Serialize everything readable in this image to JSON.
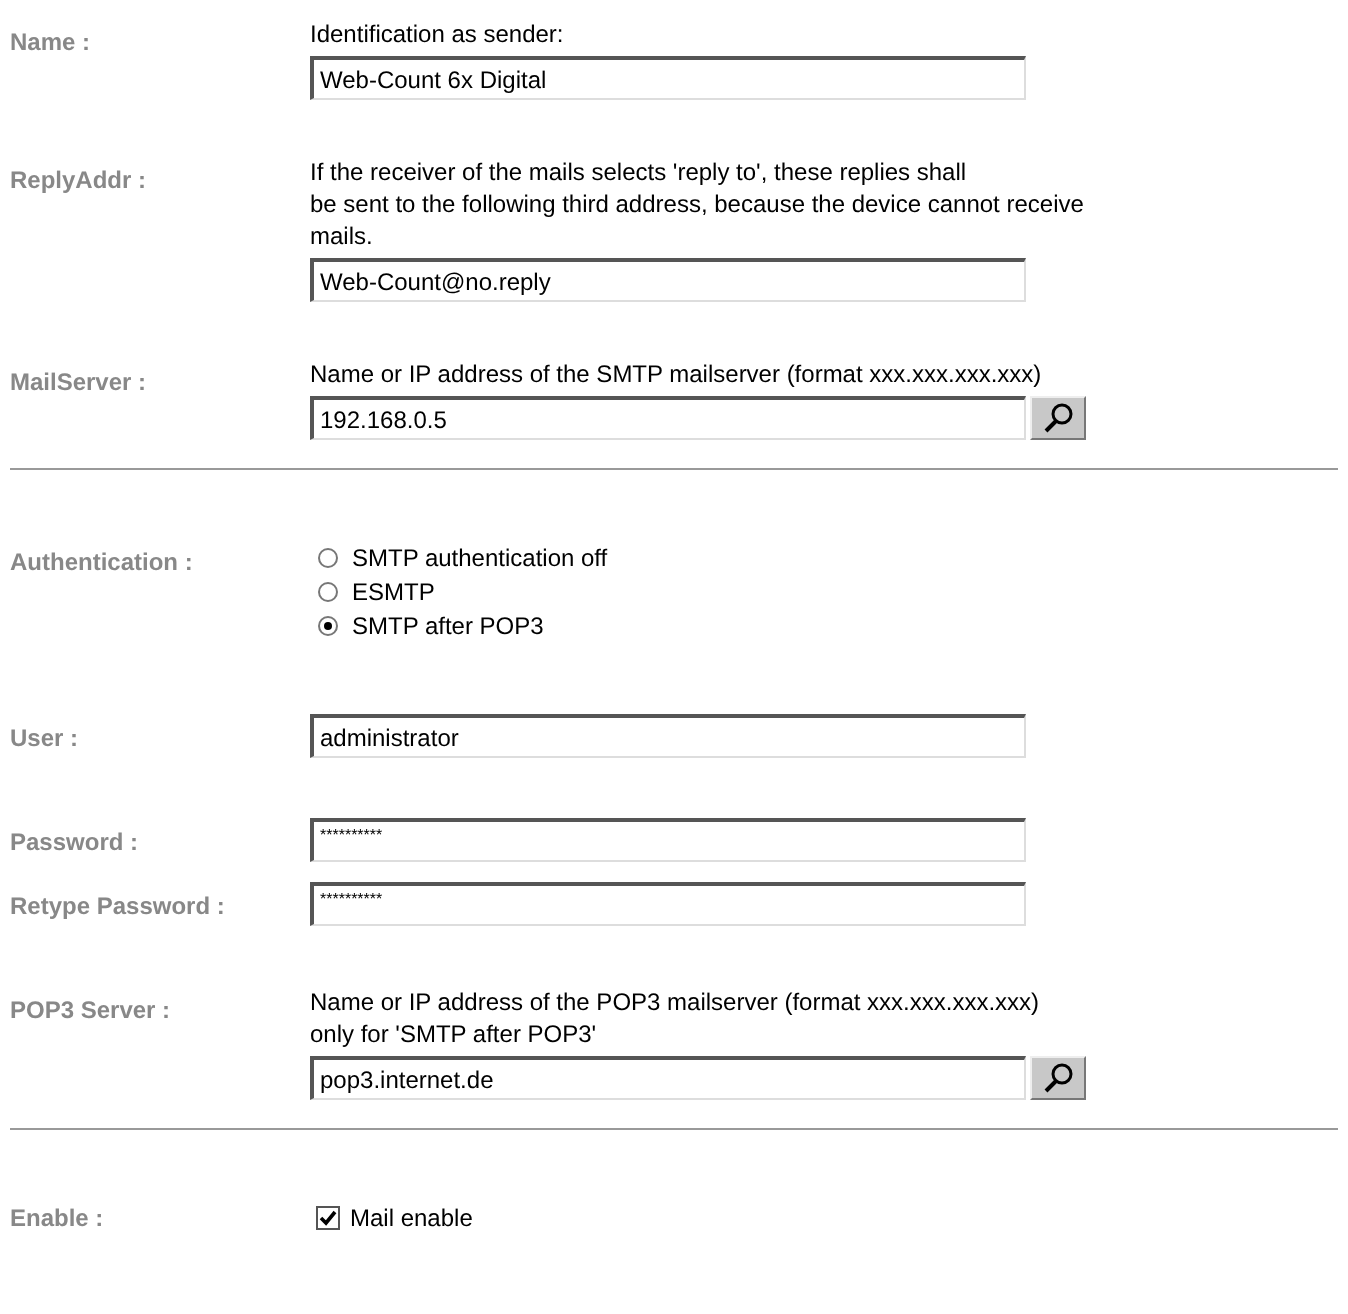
{
  "rows": [
    {
      "kind": "field",
      "label": "Name :",
      "description": [
        "Identification as sender:"
      ],
      "value": "Web-Count 6x Digital",
      "masked": false
    },
    {
      "kind": "field",
      "label": "ReplyAddr :",
      "description": [
        "If the receiver of the mails selects 'reply to', these replies shall",
        "be sent to the following third address, because the device cannot receive",
        "mails."
      ],
      "value": "Web-Count@no.reply",
      "masked": false
    },
    {
      "kind": "field",
      "label": "MailServer :",
      "description": [
        "Name or IP address of the SMTP mailserver (format xxx.xxx.xxx.xxx)"
      ],
      "value": "192.168.0.5",
      "masked": false,
      "search_button": true
    },
    {
      "kind": "divider"
    },
    {
      "kind": "radio",
      "label": "Authentication :",
      "options": [
        {
          "label": "SMTP authentication off",
          "selected": false
        },
        {
          "label": "ESMTP",
          "selected": false
        },
        {
          "label": "SMTP after POP3",
          "selected": true
        }
      ]
    },
    {
      "kind": "field",
      "label": "User :",
      "value": "administrator",
      "masked": false
    },
    {
      "kind": "field",
      "label": "Password :",
      "value": "**********",
      "masked": true
    },
    {
      "kind": "confirm_field",
      "label": "Retype Password :",
      "value": "**********",
      "masked": true
    },
    {
      "kind": "field",
      "label": "POP3 Server :",
      "description": [
        "Name or IP address of the POP3 mailserver (format xxx.xxx.xxx.xxx)",
        "only for 'SMTP after POP3'"
      ],
      "value": "pop3.internet.de",
      "masked": false,
      "search_button": true
    },
    {
      "kind": "divider"
    },
    {
      "kind": "checkbox",
      "label": "Enable :",
      "option": "Mail enable",
      "checked": true
    }
  ]
}
